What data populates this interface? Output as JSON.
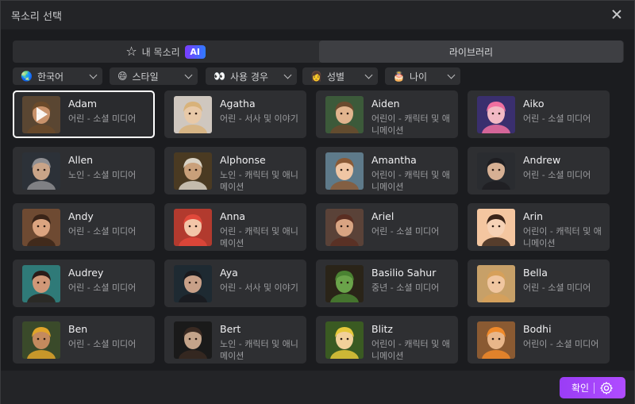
{
  "dialog": {
    "title": "목소리 선택"
  },
  "tabs": {
    "mine": "내 목소리",
    "ai_badge": "AI",
    "library": "라이브러리"
  },
  "filters": [
    {
      "icon": "🌏",
      "label": "한국어"
    },
    {
      "icon": "😄",
      "label": "스타일"
    },
    {
      "icon": "👀",
      "label": "사용 경우"
    },
    {
      "icon": "👩",
      "label": "성별"
    },
    {
      "icon": "🎂",
      "label": "나이"
    }
  ],
  "voices": [
    {
      "name": "Adam",
      "desc": "어린 - 소셜 미디어",
      "selected": true
    },
    {
      "name": "Agatha",
      "desc": "어린 - 서사 및 이야기"
    },
    {
      "name": "Aiden",
      "desc": "어린이 - 캐릭터 및 애니메이션"
    },
    {
      "name": "Aiko",
      "desc": "어린 - 소셜 미디어"
    },
    {
      "name": "Allen",
      "desc": "노인 - 소셜 미디어"
    },
    {
      "name": "Alphonse",
      "desc": "노인 - 캐릭터 및 애니메이션"
    },
    {
      "name": "Amantha",
      "desc": "어린이 - 캐릭터 및 애니메이션"
    },
    {
      "name": "Andrew",
      "desc": "어린 - 소셜 미디어"
    },
    {
      "name": "Andy",
      "desc": "어린 - 소셜 미디어"
    },
    {
      "name": "Anna",
      "desc": "어린 - 캐릭터 및 애니메이션"
    },
    {
      "name": "Ariel",
      "desc": "어린 - 소셜 미디어"
    },
    {
      "name": "Arin",
      "desc": "어린이 - 캐릭터 및 애니메이션"
    },
    {
      "name": "Audrey",
      "desc": "어린 - 소셜 미디어"
    },
    {
      "name": "Aya",
      "desc": "어린 - 서사 및 이야기"
    },
    {
      "name": "Basilio Sahur",
      "desc": "중년 - 소셜 미디어"
    },
    {
      "name": "Bella",
      "desc": "어린 - 소셜 미디어"
    },
    {
      "name": "Ben",
      "desc": "어린 - 소셜 미디어"
    },
    {
      "name": "Bert",
      "desc": "노인 - 캐릭터 및 애니메이션"
    },
    {
      "name": "Blitz",
      "desc": "어린이 - 캐릭터 및 애니메이션"
    },
    {
      "name": "Bodhi",
      "desc": "어린이 - 소셜 미디어"
    }
  ],
  "avatar_colors": [
    [
      "#5a4632",
      "#c9926b",
      "#6b4a2a"
    ],
    [
      "#cfc7bf",
      "#e8c9a8",
      "#d8b27a"
    ],
    [
      "#3c5a3a",
      "#e1b48e",
      "#6a4a2e"
    ],
    [
      "#3a2f6e",
      "#f2b9c4",
      "#f06fa0"
    ],
    [
      "#2c3138",
      "#c9a488",
      "#8e8e92"
    ],
    [
      "#4a3a22",
      "#c9a07a",
      "#d9d2c4"
    ],
    [
      "#5e7a8a",
      "#f0c6a4",
      "#8a5a36"
    ],
    [
      "#2a2c30",
      "#d6b094",
      "#1e1e22"
    ],
    [
      "#6e4a32",
      "#dba480",
      "#3a2418"
    ],
    [
      "#b23a2e",
      "#f3c6a8",
      "#e0483a"
    ],
    [
      "#5a4238",
      "#d8a482",
      "#5a2e22"
    ],
    [
      "#f4c6a0",
      "#f6d2b6",
      "#3a2418"
    ],
    [
      "#2f7a78",
      "#d09878",
      "#2a1c18"
    ],
    [
      "#1e2a32",
      "#c8a088",
      "#1a1a1e"
    ],
    [
      "#2a2418",
      "#6aa34a",
      "#4a8232"
    ],
    [
      "#c7a068",
      "#f0c6a0",
      "#d6a05a"
    ],
    [
      "#3a4a2a",
      "#c48a5e",
      "#e0a42a"
    ],
    [
      "#1a1a1a",
      "#c4a48a",
      "#3a2a22"
    ],
    [
      "#3a5a22",
      "#f2d09a",
      "#e6c83a"
    ],
    [
      "#8a5a32",
      "#e8b68a",
      "#f08a2a"
    ]
  ],
  "footer": {
    "confirm": "확인"
  }
}
